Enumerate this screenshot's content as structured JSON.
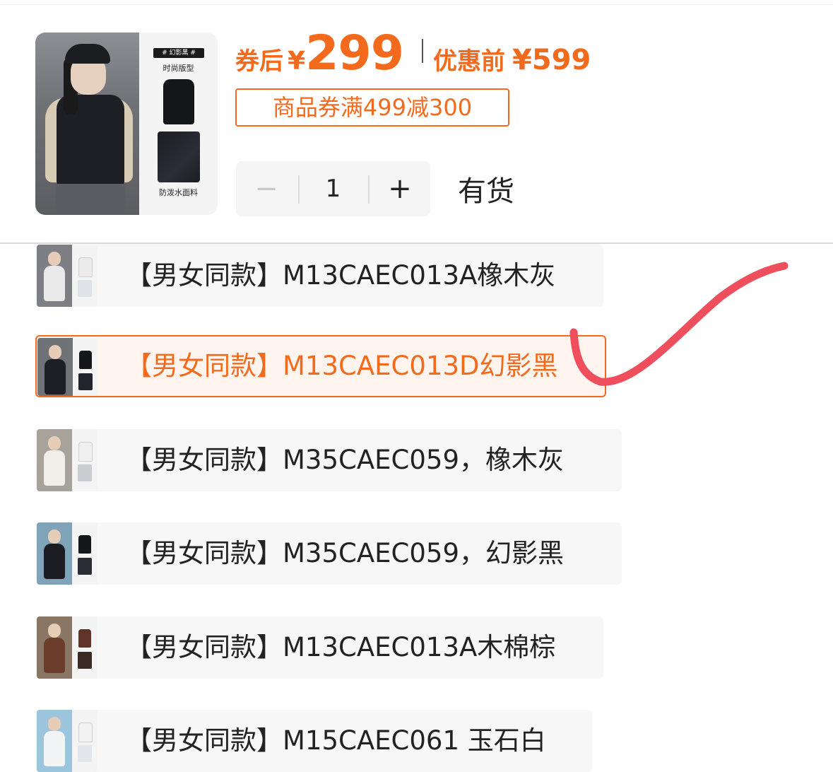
{
  "header": {
    "product_image_alt": "",
    "thumb_tag": "# 幻影黑 #",
    "thumb_caption_top": "时尚版型",
    "thumb_caption_bottom": "防泼水面料",
    "after_coupon_label": "券后",
    "currency": "¥",
    "after_coupon_price": "299",
    "before_label": "优惠前",
    "before_price": "¥599",
    "coupon_text": "商品券满499减300",
    "quantity": {
      "minus": "−",
      "value": "1",
      "plus": "+"
    },
    "stock_status": "有货"
  },
  "variants": [
    {
      "label": "【男女同款】M13CAEC013A橡木灰",
      "selected": false
    },
    {
      "label": "【男女同款】M13CAEC013D幻影黑",
      "selected": true
    },
    {
      "label": "【男女同款】M35CAEC059，橡木灰",
      "selected": false
    },
    {
      "label": "【男女同款】M35CAEC059，幻影黑",
      "selected": false
    },
    {
      "label": "【男女同款】M13CAEC013A木棉棕",
      "selected": false
    },
    {
      "label": "【男女同款】M15CAEC061 玉石白",
      "selected": false
    }
  ],
  "colors": {
    "accent": "#f46a1c",
    "selected_bg": "#fff4ee",
    "annotation_mark": "#ef4e5c"
  }
}
